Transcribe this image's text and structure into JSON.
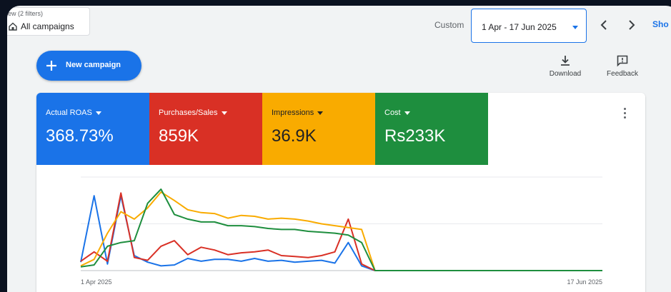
{
  "filter_chip": {
    "count_text": "ew (2 filters)",
    "scope_label": "All campaigns",
    "icon": "home-icon"
  },
  "date_range": {
    "range_type": "Custom",
    "value": "1 Apr - 17 Jun 2025",
    "prev_icon": "chevron-left-icon",
    "next_icon": "chevron-right-icon",
    "show_link": "Sho"
  },
  "actions": {
    "new_campaign_label": "New campaign",
    "download_label": "Download",
    "feedback_label": "Feedback"
  },
  "metrics": [
    {
      "name": "Actual ROAS",
      "value": "368.73%",
      "color": "#1a73e8"
    },
    {
      "name": "Purchases/Sales",
      "value": "859K",
      "color": "#d93025"
    },
    {
      "name": "Impressions",
      "value": "36.9K",
      "color": "#f9ab00"
    },
    {
      "name": "Cost",
      "value": "Rs233K",
      "color": "#1e8e3e"
    }
  ],
  "chart_data": {
    "type": "line",
    "x_start_label": "1 Apr 2025",
    "x_end_label": "17 Jun 2025",
    "grid": true,
    "series": [
      {
        "color": "#1a73e8",
        "values": [
          0.09,
          0.8,
          0.07,
          0.8,
          0.16,
          0.09,
          0.05,
          0.06,
          0.13,
          0.1,
          0.12,
          0.12,
          0.1,
          0.13,
          0.1,
          0.11,
          0.09,
          0.1,
          0.11,
          0.08,
          0.3,
          0.05,
          0.0,
          0.0,
          0.0,
          0.0,
          0.0,
          0.0,
          0.0,
          0.0,
          0.0,
          0.0,
          0.0,
          0.0,
          0.0,
          0.0,
          0.0,
          0.0,
          0.0,
          0.0
        ]
      },
      {
        "color": "#d93025",
        "values": [
          0.1,
          0.2,
          0.1,
          0.83,
          0.14,
          0.11,
          0.26,
          0.32,
          0.17,
          0.25,
          0.22,
          0.17,
          0.19,
          0.2,
          0.22,
          0.16,
          0.15,
          0.14,
          0.16,
          0.2,
          0.55,
          0.07,
          0.0,
          0.0,
          0.0,
          0.0,
          0.0,
          0.0,
          0.0,
          0.0,
          0.0,
          0.0,
          0.0,
          0.0,
          0.0,
          0.0,
          0.0,
          0.0,
          0.0,
          0.0
        ]
      },
      {
        "color": "#f9ab00",
        "values": [
          0.05,
          0.12,
          0.4,
          0.63,
          0.55,
          0.67,
          0.84,
          0.75,
          0.65,
          0.62,
          0.61,
          0.56,
          0.59,
          0.58,
          0.55,
          0.56,
          0.55,
          0.53,
          0.5,
          0.48,
          0.46,
          0.44,
          0.0,
          0.0,
          0.0,
          0.0,
          0.0,
          0.0,
          0.0,
          0.0,
          0.0,
          0.0,
          0.0,
          0.0,
          0.0,
          0.0,
          0.0,
          0.0,
          0.0,
          0.0
        ]
      },
      {
        "color": "#1e8e3e",
        "values": [
          0.04,
          0.06,
          0.26,
          0.3,
          0.32,
          0.72,
          0.87,
          0.6,
          0.55,
          0.52,
          0.52,
          0.48,
          0.48,
          0.47,
          0.45,
          0.44,
          0.44,
          0.42,
          0.41,
          0.4,
          0.38,
          0.3,
          0.0,
          0.0,
          0.0,
          0.0,
          0.0,
          0.0,
          0.0,
          0.0,
          0.0,
          0.0,
          0.0,
          0.0,
          0.0,
          0.0,
          0.0,
          0.0,
          0.0,
          0.0
        ]
      }
    ]
  }
}
